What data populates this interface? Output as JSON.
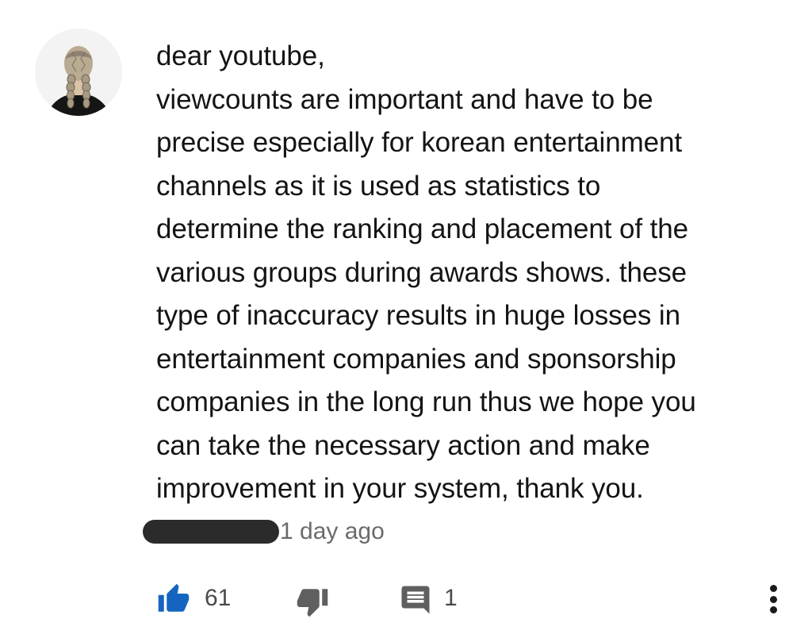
{
  "comment": {
    "lines": [
      "dear youtube,",
      "viewcounts are important and have to be",
      "precise especially for korean entertainment",
      "channels as it is used as statistics to",
      "determine the ranking and placement of the",
      "various groups during awards shows. these",
      "type of inaccuracy results in huge losses in",
      "entertainment companies and sponsorship",
      "companies in the long run thus we hope you",
      "can take the necessary action and make",
      "improvement in your system, thank you."
    ],
    "timestamp": "1 day ago"
  },
  "actions": {
    "like_count": "61",
    "reply_count": "1"
  },
  "icons": {
    "like": "thumbs-up-icon",
    "dislike": "thumbs-down-icon",
    "reply": "comment-icon",
    "menu": "more-vertical-icon"
  },
  "colors": {
    "like_active": "#1565c0",
    "icon_gray": "#5f5f5f",
    "redaction": "#2b2b2b"
  }
}
